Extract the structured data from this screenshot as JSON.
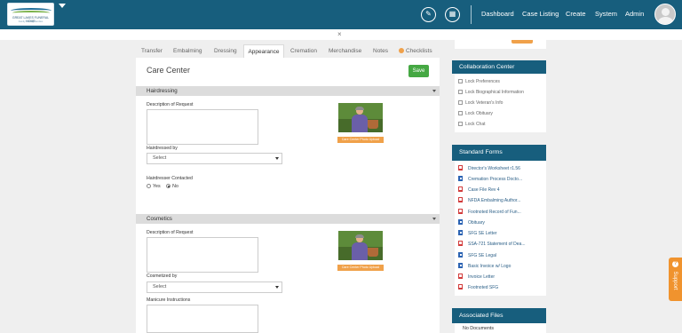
{
  "header": {
    "logo_title": "GREAT LAKES FUNERAL HOME",
    "logo_subtitle": "Family Serving Families",
    "nav": [
      "Dashboard",
      "Case Listing",
      "Create",
      "System",
      "Admin"
    ]
  },
  "subbar": {
    "close_glyph": "×"
  },
  "tabs": [
    "Transfer",
    "Embalming",
    "Dressing",
    "Appearance",
    "Cremation",
    "Merchandise",
    "Notes",
    "Checklists"
  ],
  "active_tab": "Appearance",
  "main": {
    "title": "Care Center",
    "save_label": "Save",
    "hairdressing": {
      "heading": "Hairdressing",
      "description_label": "Description of Request",
      "photo_tag": "Care Center Photo Upload",
      "hairdresser_label": "Hairdressed by",
      "hairdresser_value": "Select",
      "contacted_label": "Hairdresser Contacted",
      "yes_label": "Yes",
      "no_label": "No",
      "selected": "No"
    },
    "cosmetics": {
      "heading": "Cosmetics",
      "description_label": "Description of Request",
      "photo_tag": "Care Center Photo Upload",
      "cosmetized_label": "Cosmetized by",
      "cosmetized_value": "Select",
      "manicure_label": "Manicure Instructions"
    }
  },
  "collaboration": {
    "heading": "Collaboration Center",
    "items": [
      "Lock Preferences",
      "Lock Biographical Information",
      "Lock Veteran's Info",
      "Lock Obituary",
      "Lock Chat"
    ]
  },
  "standard_forms": {
    "heading": "Standard Forms",
    "items": [
      {
        "label": "Director's Worksheet r1.56",
        "icon": "pdf-icon"
      },
      {
        "label": "Cremation Process Docto...",
        "icon": "doc-icon"
      },
      {
        "label": "Case File Rev 4",
        "icon": "pdf-icon"
      },
      {
        "label": "NFDA Embalming Author...",
        "icon": "pdf-icon"
      },
      {
        "label": "Footnoted Record of Fun...",
        "icon": "pdf-icon"
      },
      {
        "label": "Obituary",
        "icon": "doc-icon"
      },
      {
        "label": "SFG SE Letter",
        "icon": "doc-icon"
      },
      {
        "label": "SSA-721 Statement of Dea...",
        "icon": "pdf-icon"
      },
      {
        "label": "SFG SE Legal",
        "icon": "doc-icon"
      },
      {
        "label": "Basic Invoice w/ Logo",
        "icon": "doc-icon"
      },
      {
        "label": "Invoice Letter",
        "icon": "pdf-icon"
      },
      {
        "label": "Footnoted SFG",
        "icon": "pdf-icon"
      }
    ]
  },
  "associated_files": {
    "heading": "Associated Files",
    "empty_text": "No Documents"
  },
  "support": {
    "label": "Support"
  },
  "colors": {
    "header_bg": "#175e7d",
    "save_green": "#45a843",
    "accent_orange": "#f0a14a"
  }
}
